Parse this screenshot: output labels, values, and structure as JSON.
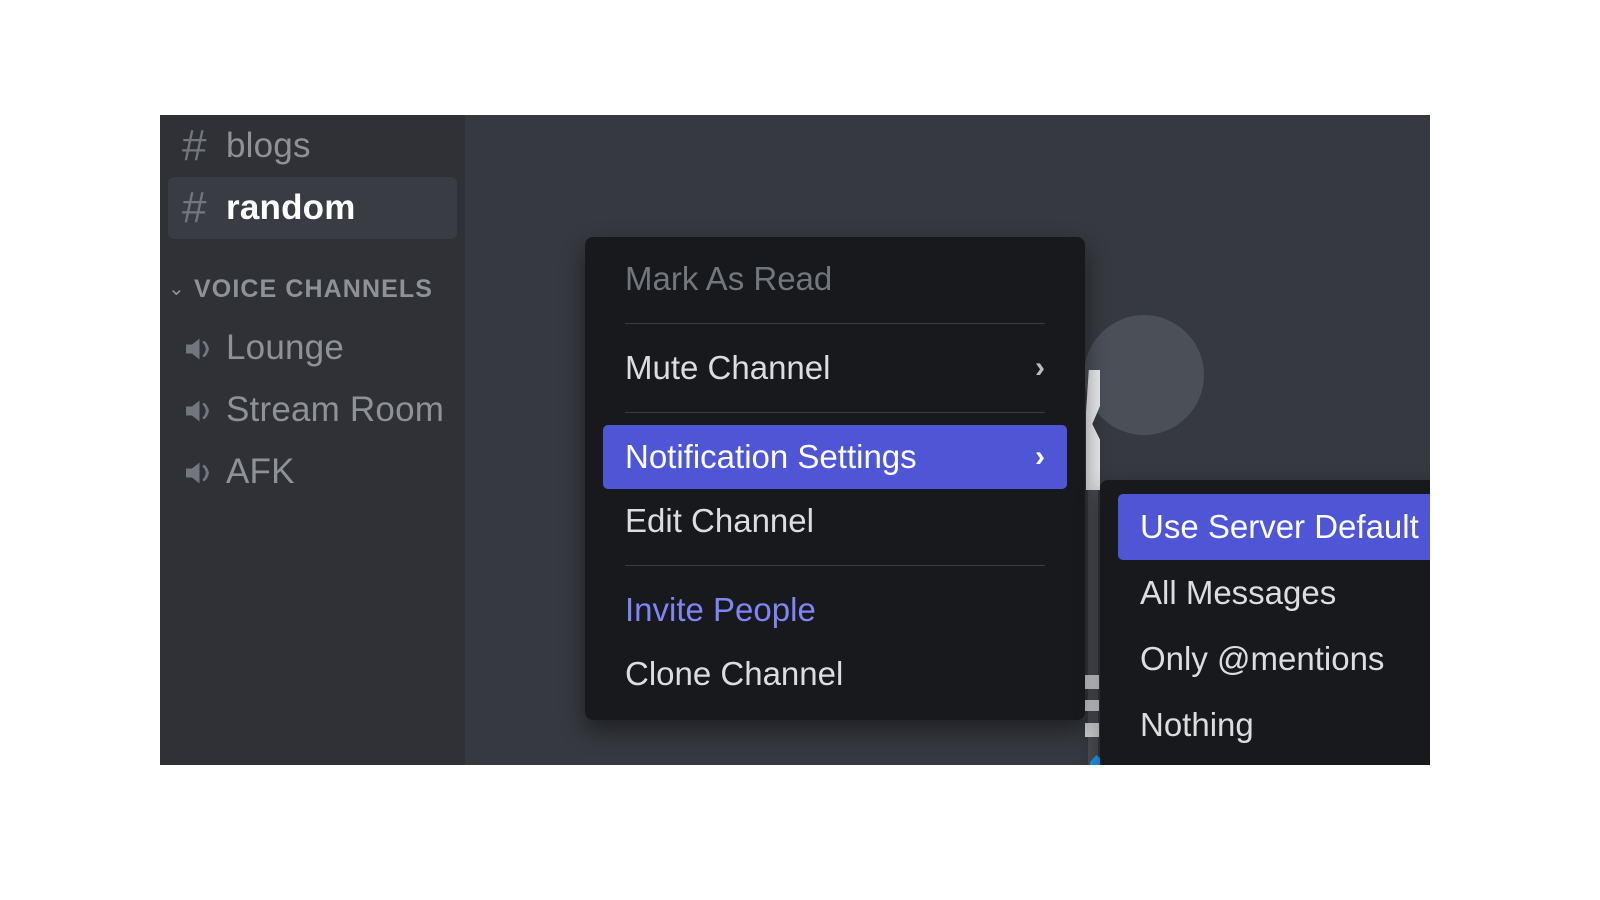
{
  "theme": {
    "accent": "#4f56d6",
    "menu_bg": "#18191c",
    "sidebar_bg": "#2f3136",
    "chat_bg": "#36393f",
    "text": "#dcddde",
    "muted_text": "#8e9297",
    "disabled_text": "#72767d",
    "brand_link": "#7f85f5"
  },
  "sidebar": {
    "text_channels": [
      {
        "name": "blogs",
        "icon": "hash-icon",
        "active": false,
        "prefix": "#"
      },
      {
        "name": "random",
        "icon": "hash-icon",
        "active": true,
        "prefix": "#"
      }
    ],
    "category": {
      "label": "VOICE CHANNELS",
      "arrow": "⌄"
    },
    "voice_channels": [
      {
        "name": "Lounge",
        "icon": "speaker-icon"
      },
      {
        "name": "Stream Room",
        "icon": "speaker-icon"
      },
      {
        "name": "AFK",
        "icon": "speaker-icon"
      }
    ]
  },
  "context_menu": {
    "items": [
      {
        "label": "Mark As Read",
        "state": "disabled",
        "submenu": false
      },
      {
        "label": "Mute Channel",
        "state": "normal",
        "submenu": true,
        "chevron": "›"
      },
      {
        "label": "Notification Settings",
        "state": "selected",
        "submenu": true,
        "chevron": "›"
      },
      {
        "label": "Edit Channel",
        "state": "normal",
        "submenu": false
      },
      {
        "label": "Invite People",
        "state": "brand",
        "submenu": false
      },
      {
        "label": "Clone Channel",
        "state": "normal",
        "submenu": false
      }
    ]
  },
  "notification_submenu": {
    "options": [
      {
        "label": "Use Server Default",
        "selected": true
      },
      {
        "label": "All Messages",
        "selected": false
      },
      {
        "label": "Only @mentions",
        "selected": false
      },
      {
        "label": "Nothing",
        "selected": false
      }
    ]
  }
}
